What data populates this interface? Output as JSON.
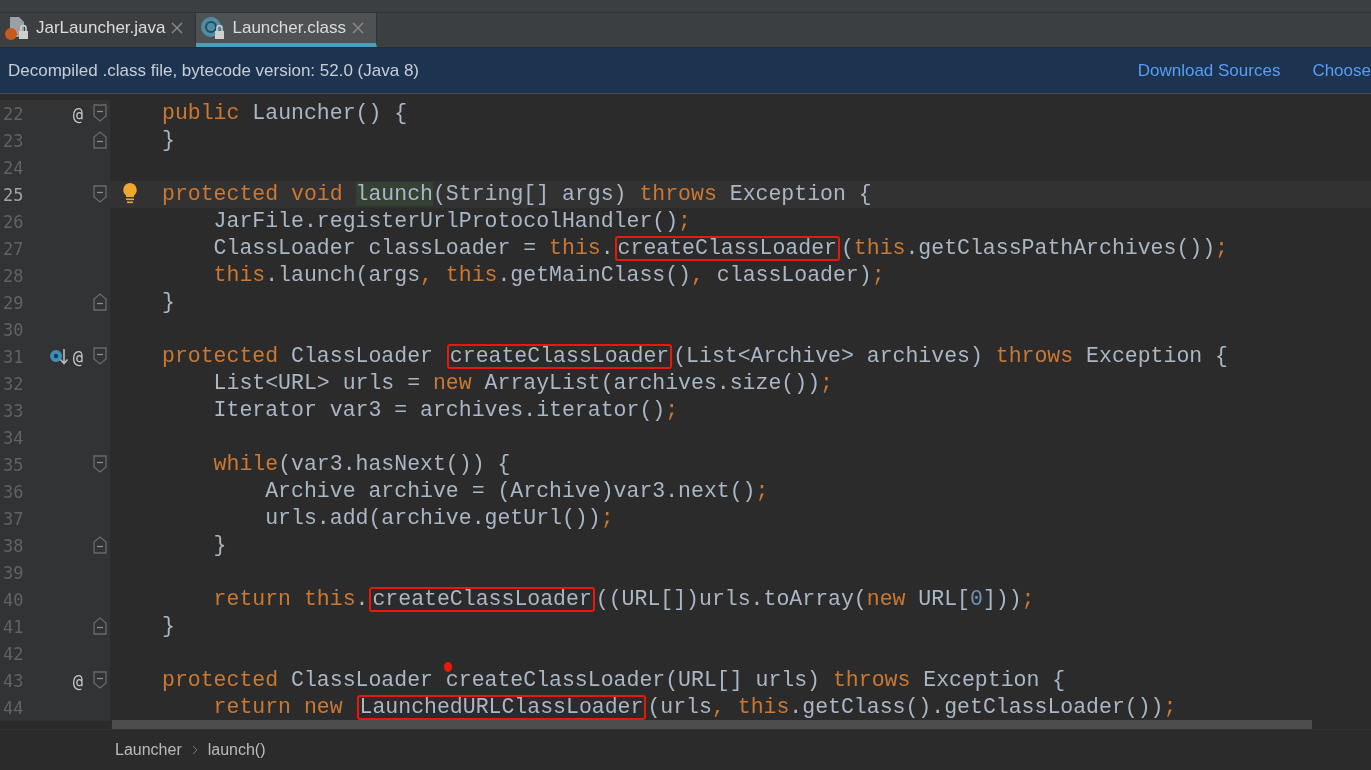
{
  "tabs": [
    {
      "label": "JarLauncher.java",
      "kind": "java",
      "selected": false
    },
    {
      "label": "Launcher.class",
      "kind": "class",
      "selected": true
    }
  ],
  "banner": {
    "text": "Decompiled .class file, bytecode version: 52.0 (Java 8)",
    "links": [
      "Download Sources",
      "Choose"
    ]
  },
  "lines": [
    {
      "number": "22",
      "current": false,
      "marks": [
        "@"
      ],
      "fold_start": true,
      "segments": [
        {
          "t": "public",
          "kind": "kw"
        },
        {
          "t": " Launcher() {",
          "kind": "plain"
        }
      ]
    },
    {
      "number": "23",
      "current": false,
      "fold_end": true,
      "segments": [
        {
          "t": "}",
          "kind": "plain"
        }
      ]
    },
    {
      "number": "24",
      "current": false
    },
    {
      "number": "25",
      "current": true,
      "bulb": true,
      "fold_start": true,
      "segments": [
        {
          "t": "protected void ",
          "kind": "kw"
        },
        {
          "t": "launch",
          "kind": "usage"
        },
        {
          "t": "(String[] args) ",
          "kind": "plain"
        },
        {
          "t": "throws",
          "kind": "kw"
        },
        {
          "t": " Exception {",
          "kind": "plain"
        }
      ]
    },
    {
      "number": "26",
      "current": false,
      "segments": [
        {
          "t": "    JarFile.registerUrlProtocolHandler()",
          "kind": "plain"
        },
        {
          "t": ";",
          "kind": "kw"
        }
      ]
    },
    {
      "number": "27",
      "current": false,
      "segments": [
        {
          "t": "    ClassLoader classLoader = ",
          "kind": "plain"
        },
        {
          "t": "this",
          "kind": "kw"
        },
        {
          "t": ".",
          "kind": "plain"
        },
        {
          "t": "createClassLoader",
          "kind": "plain",
          "boxed": true
        },
        {
          "t": "(",
          "kind": "plain"
        },
        {
          "t": "this",
          "kind": "kw"
        },
        {
          "t": ".getClassPathArchives())",
          "kind": "plain"
        },
        {
          "t": ";",
          "kind": "kw"
        }
      ]
    },
    {
      "number": "28",
      "current": false,
      "segments": [
        {
          "t": "    this",
          "kind": "kw"
        },
        {
          "t": ".launch(args",
          "kind": "plain"
        },
        {
          "t": ", this",
          "kind": "kw"
        },
        {
          "t": ".getMainClass()",
          "kind": "plain"
        },
        {
          "t": ",",
          "kind": "kw"
        },
        {
          "t": " classLoader)",
          "kind": "plain"
        },
        {
          "t": ";",
          "kind": "kw"
        }
      ]
    },
    {
      "number": "29",
      "current": false,
      "fold_end": true,
      "segments": [
        {
          "t": "}",
          "kind": "plain"
        }
      ]
    },
    {
      "number": "30",
      "current": false
    },
    {
      "number": "31",
      "current": false,
      "marks": [
        "@"
      ],
      "override": true,
      "fold_start": true,
      "segments": [
        {
          "t": "protected",
          "kind": "kw"
        },
        {
          "t": " ClassLoader ",
          "kind": "plain"
        },
        {
          "t": "createClassLoader",
          "kind": "plain",
          "boxed": true
        },
        {
          "t": "(List<Archive> archives) ",
          "kind": "plain"
        },
        {
          "t": "throws",
          "kind": "kw"
        },
        {
          "t": " Exception {",
          "kind": "plain"
        }
      ]
    },
    {
      "number": "32",
      "current": false,
      "segments": [
        {
          "t": "    List<URL> urls = ",
          "kind": "plain"
        },
        {
          "t": "new",
          "kind": "kw"
        },
        {
          "t": " ArrayList(archives.size())",
          "kind": "plain"
        },
        {
          "t": ";",
          "kind": "kw"
        }
      ]
    },
    {
      "number": "33",
      "current": false,
      "segments": [
        {
          "t": "    Iterator var3 = archives.iterator()",
          "kind": "plain"
        },
        {
          "t": ";",
          "kind": "kw"
        }
      ]
    },
    {
      "number": "34",
      "current": false
    },
    {
      "number": "35",
      "current": false,
      "fold_start": true,
      "segments": [
        {
          "t": "    while",
          "kind": "kw"
        },
        {
          "t": "(var3.hasNext()) {",
          "kind": "plain"
        }
      ]
    },
    {
      "number": "36",
      "current": false,
      "segments": [
        {
          "t": "        Archive archive = (Archive)var3.next()",
          "kind": "plain"
        },
        {
          "t": ";",
          "kind": "kw"
        }
      ]
    },
    {
      "number": "37",
      "current": false,
      "segments": [
        {
          "t": "        urls.add(archive.getUrl())",
          "kind": "plain"
        },
        {
          "t": ";",
          "kind": "kw"
        }
      ]
    },
    {
      "number": "38",
      "current": false,
      "fold_end": true,
      "segments": [
        {
          "t": "    }",
          "kind": "plain"
        }
      ]
    },
    {
      "number": "39",
      "current": false
    },
    {
      "number": "40",
      "current": false,
      "segments": [
        {
          "t": "    return this",
          "kind": "kw"
        },
        {
          "t": ".",
          "kind": "plain"
        },
        {
          "t": "createClassLoader",
          "kind": "plain",
          "boxed": true
        },
        {
          "t": "((URL[])urls.toArray(",
          "kind": "plain"
        },
        {
          "t": "new",
          "kind": "kw"
        },
        {
          "t": " URL[",
          "kind": "plain"
        },
        {
          "t": "0",
          "kind": "num"
        },
        {
          "t": "]))",
          "kind": "plain"
        },
        {
          "t": ";",
          "kind": "kw"
        }
      ]
    },
    {
      "number": "41",
      "current": false,
      "fold_end": true,
      "segments": [
        {
          "t": "}",
          "kind": "plain"
        }
      ]
    },
    {
      "number": "42",
      "current": false,
      "dot": true
    },
    {
      "number": "43",
      "current": false,
      "marks": [
        "@"
      ],
      "fold_start": true,
      "segments": [
        {
          "t": "protected",
          "kind": "kw"
        },
        {
          "t": " ClassLoader createClassLoader(URL[] urls) ",
          "kind": "plain"
        },
        {
          "t": "throws",
          "kind": "kw"
        },
        {
          "t": " Exception {",
          "kind": "plain"
        }
      ]
    },
    {
      "number": "44",
      "current": false,
      "segments": [
        {
          "t": "    return new ",
          "kind": "kw"
        },
        {
          "t": "LaunchedURLClassLoader",
          "kind": "plain",
          "boxed": true
        },
        {
          "t": "(urls",
          "kind": "plain"
        },
        {
          "t": ", this",
          "kind": "kw"
        },
        {
          "t": ".getClass().getClassLoader())",
          "kind": "plain"
        },
        {
          "t": ";",
          "kind": "kw"
        }
      ]
    }
  ],
  "breadcrumbs": [
    "Launcher",
    "launch()"
  ]
}
